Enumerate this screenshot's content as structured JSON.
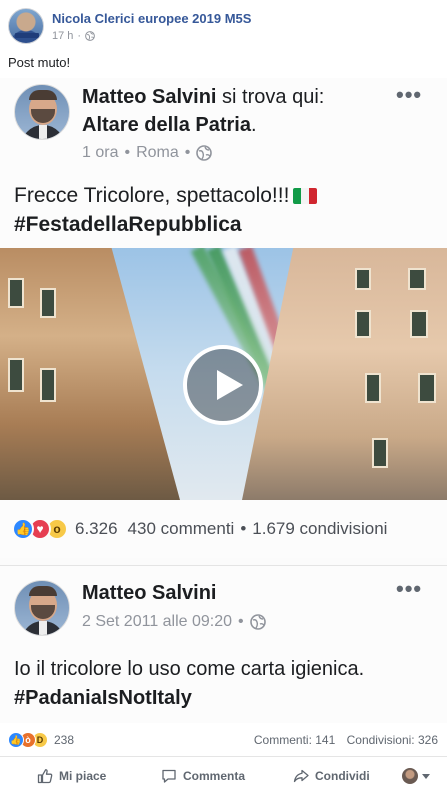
{
  "post": {
    "author": "Nicola Clerici europee 2019 M5S",
    "time": "17 h",
    "privacy_icon": "globe-icon",
    "text": "Post muto!"
  },
  "shared_screenshot": {
    "post1": {
      "author": "Matteo Salvini",
      "action": "si trova qui:",
      "place": "Altare della Patria",
      "place_suffix": ".",
      "time": "1 ora",
      "location": "Roma",
      "more": "•••",
      "text_line1": "Frecce Tricolore, spettacolo!!!",
      "hashtag": "#FestadellaRepubblica",
      "reactions_count": "6.326",
      "comments": "430 commenti",
      "shares": "1.679 condivisioni",
      "separator": "•"
    },
    "post2": {
      "author": "Matteo Salvini",
      "date": "2 Set 2011 alle 09:20",
      "more": "•••",
      "text_line1": "Io il tricolore lo uso come carta igienica.",
      "hashtag": "#PadaniaIsNotItaly"
    }
  },
  "stats": {
    "reactions": "238",
    "comments": "Commenti: 141",
    "shares": "Condivisioni: 326"
  },
  "actions": {
    "like": "Mi piace",
    "comment": "Commenta",
    "share": "Condividi"
  },
  "colors": {
    "link_blue": "#365899",
    "meta_gray": "#90949c",
    "like_blue": "#2d88ff"
  }
}
